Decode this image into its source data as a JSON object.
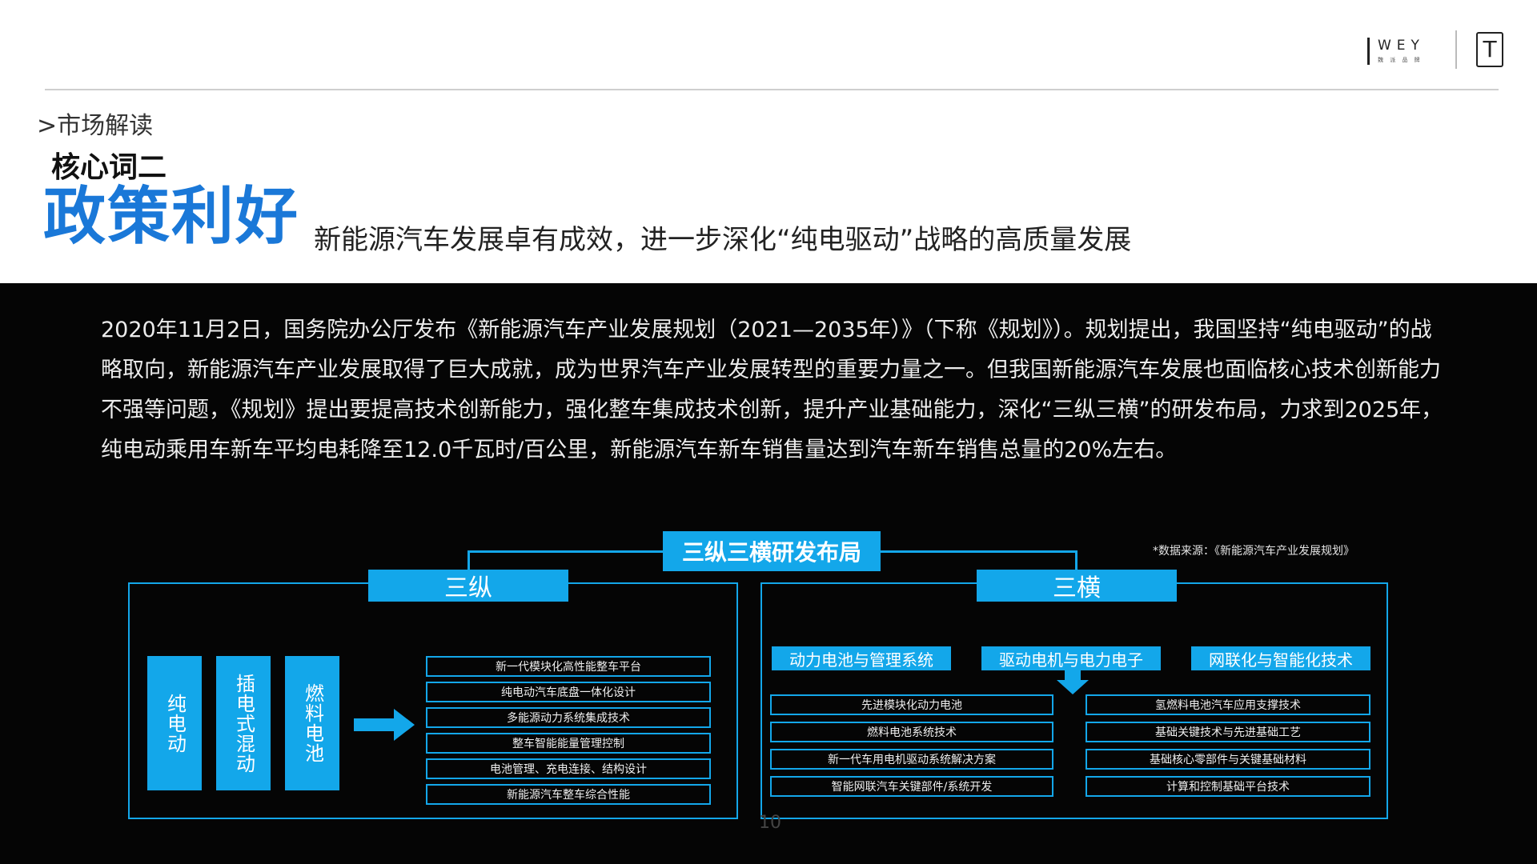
{
  "header": {
    "logo_wey": "WEY",
    "logo_wey_sub": "魏 派 品 牌",
    "logo_tank": "T"
  },
  "title_block": {
    "section_tag": ">市场解读",
    "subheading": "核心词二",
    "big_title": "政策利好",
    "tagline": "新能源汽车发展卓有成效，进一步深化“纯电驱动”战略的高质量发展"
  },
  "paragraph": "2020年11月2日，国务院办公厅发布《新能源汽车产业发展规划（2021—2035年）》（下称《规划》）。规划提出，我国坚持“纯电驱动”的战略取向，新能源汽车产业发展取得了巨大成就，成为世界汽车产业发展转型的重要力量之一。但我国新能源汽车发展也面临核心技术创新能力不强等问题，《规划》提出要提高技术创新能力，强化整车集成技术创新，提升产业基础能力，深化“三纵三横”的研发布局，力求到2025年，纯电动乘用车新车平均电耗降至12.0千瓦时/百公里，新能源汽车新车销售量达到汽车新车销售总量的20%左右。",
  "diagram": {
    "root": "三纵三横研发布局",
    "source": "*数据来源：《新能源汽车产业发展规划》",
    "zong": {
      "title": "三纵",
      "verticals": [
        "纯电动",
        "插电式混动",
        "燃料电池"
      ],
      "items": [
        "新一代模块化高性能整车平台",
        "纯电动汽车底盘一体化设计",
        "多能源动力系统集成技术",
        "整车智能能量管理控制",
        "电池管理、充电连接、结构设计",
        "新能源汽车整车综合性能"
      ]
    },
    "heng": {
      "title": "三横",
      "heads": [
        "动力电池与管理系统",
        "驱动电机与电力电子",
        "网联化与智能化技术"
      ],
      "left_items": [
        "先进模块化动力电池",
        "燃料电池系统技术",
        "新一代车用电机驱动系统解决方案",
        "智能网联汽车关键部件/系统开发"
      ],
      "right_items": [
        "氢燃料电池汽车应用支撑技术",
        "基础关键技术与先进基础工艺",
        "基础核心零部件与关键基础材料",
        "计算和控制基础平台技术"
      ]
    }
  },
  "page_number": "10",
  "colors": {
    "accent": "#13a7ea",
    "title_blue": "#1a78d8",
    "panel": "#050505"
  }
}
